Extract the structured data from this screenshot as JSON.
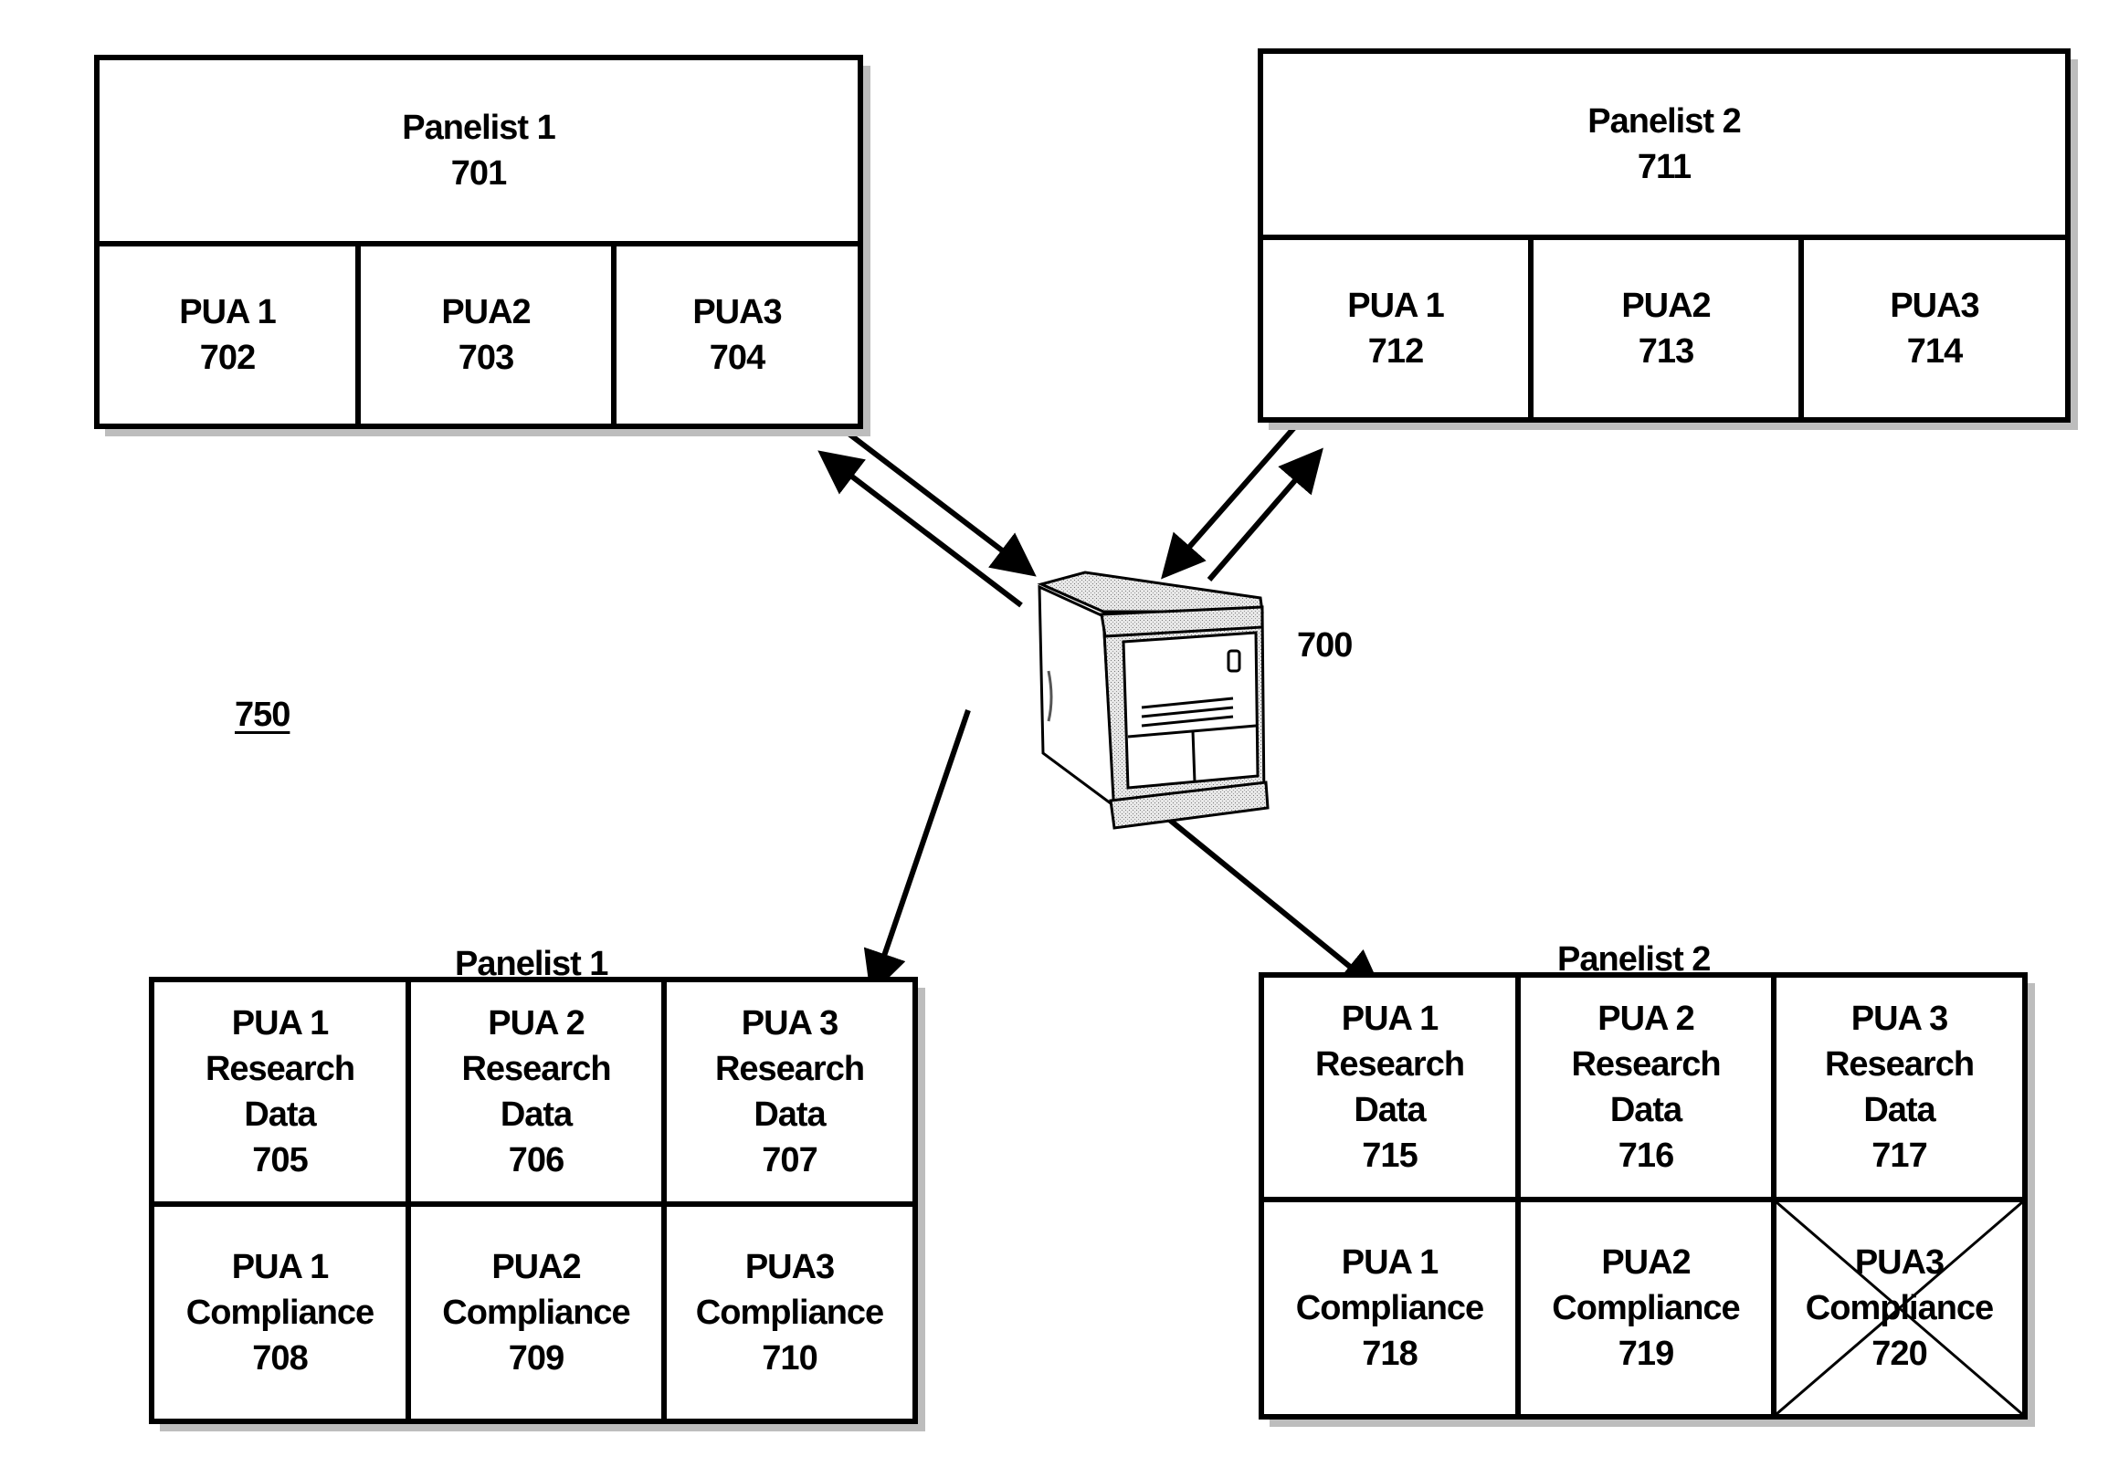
{
  "figure_ref": "750",
  "server": {
    "label": "700",
    "icon": "server-tower-icon"
  },
  "top_left": {
    "title": "Panelist 1",
    "ref": "701",
    "puas": [
      {
        "name": "PUA 1",
        "ref": "702"
      },
      {
        "name": "PUA2",
        "ref": "703"
      },
      {
        "name": "PUA3",
        "ref": "704"
      }
    ]
  },
  "top_right": {
    "title": "Panelist 2",
    "ref": "711",
    "puas": [
      {
        "name": "PUA 1",
        "ref": "712"
      },
      {
        "name": "PUA2",
        "ref": "713"
      },
      {
        "name": "PUA3",
        "ref": "714"
      }
    ]
  },
  "bottom_left": {
    "title": "Panelist 1",
    "research": [
      {
        "name": "PUA 1",
        "line2": "Research",
        "line3": "Data",
        "ref": "705"
      },
      {
        "name": "PUA 2",
        "line2": "Research",
        "line3": "Data",
        "ref": "706"
      },
      {
        "name": "PUA 3",
        "line2": "Research",
        "line3": "Data",
        "ref": "707"
      }
    ],
    "compliance": [
      {
        "name": "PUA 1",
        "line2": "Compliance",
        "ref": "708"
      },
      {
        "name": "PUA2",
        "line2": "Compliance",
        "ref": "709"
      },
      {
        "name": "PUA3",
        "line2": "Compliance",
        "ref": "710"
      }
    ]
  },
  "bottom_right": {
    "title": "Panelist 2",
    "research": [
      {
        "name": "PUA 1",
        "line2": "Research",
        "line3": "Data",
        "ref": "715"
      },
      {
        "name": "PUA 2",
        "line2": "Research",
        "line3": "Data",
        "ref": "716"
      },
      {
        "name": "PUA 3",
        "line2": "Research",
        "line3": "Data",
        "ref": "717"
      }
    ],
    "compliance": [
      {
        "name": "PUA 1",
        "line2": "Compliance",
        "ref": "718"
      },
      {
        "name": "PUA2",
        "line2": "Compliance",
        "ref": "719"
      },
      {
        "name": "PUA3",
        "line2": "Compliance",
        "ref": "720",
        "crossed_out": true
      }
    ]
  }
}
